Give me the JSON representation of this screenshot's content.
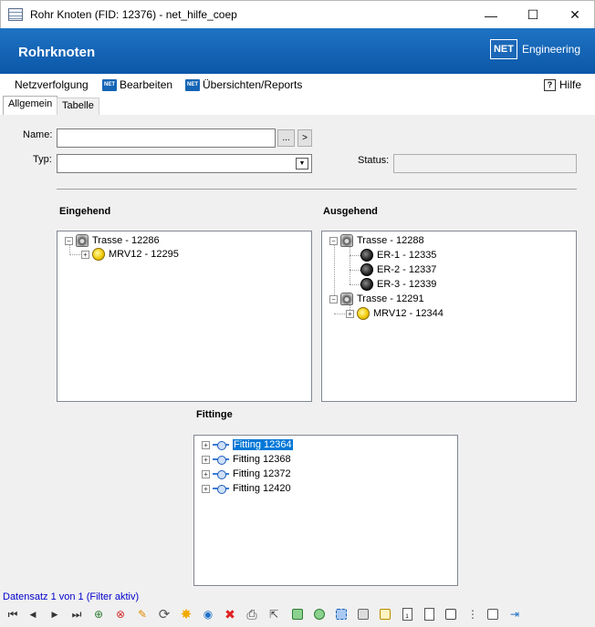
{
  "window": {
    "title": "Rohr Knoten (FID: 12376) - net_hilfe_coep",
    "minimize_glyph": "—",
    "maximize_glyph": "☐",
    "close_glyph": "✕"
  },
  "banner": {
    "heading": "Rohrknoten",
    "logo_box": "NET",
    "logo_text": "Engineering"
  },
  "menu": {
    "netzverfolgung": "Netzverfolgung",
    "bearbeiten": "Bearbeiten",
    "uebersichten": "Übersichten/Reports",
    "hilfe": "Hilfe",
    "net_icon_text": "NET",
    "help_icon_text": "?"
  },
  "tabs": [
    {
      "label": "Allgemein"
    },
    {
      "label": "Tabelle"
    }
  ],
  "form": {
    "name_label": "Name:",
    "name_value": "",
    "browse_label": "...",
    "goto_label": ">",
    "typ_label": "Typ:",
    "typ_value": "",
    "status_label": "Status:",
    "status_value": ""
  },
  "eingehend": {
    "title": "Eingehend",
    "nodes": [
      {
        "label": "Trasse - 12286"
      },
      {
        "label": "MRV12 - 12295"
      }
    ]
  },
  "ausgehend": {
    "title": "Ausgehend",
    "nodes": [
      {
        "label": "Trasse - 12288"
      },
      {
        "label": "ER-1 - 12335"
      },
      {
        "label": "ER-2 - 12337"
      },
      {
        "label": "ER-3 - 12339"
      },
      {
        "label": "Trasse - 12291"
      },
      {
        "label": "MRV12 - 12344"
      }
    ]
  },
  "fittinge": {
    "title": "Fittinge",
    "nodes": [
      {
        "label": "Fitting 12364"
      },
      {
        "label": "Fitting 12368"
      },
      {
        "label": "Fitting 12372"
      },
      {
        "label": "Fitting 12420"
      }
    ]
  },
  "status_bar": {
    "text": "Datensatz 1 von 1 (Filter aktiv)"
  },
  "toolbar": {
    "first": "⏮",
    "prev": "◀",
    "next": "▶",
    "last": "⏭",
    "filter_add": "⊕",
    "filter_remove": "⊗",
    "edit": "✎",
    "refresh": "⟳",
    "new": "✸",
    "web": "◉",
    "delete": "✖",
    "print": "⎙",
    "select": "⇱",
    "doc_text": "1"
  },
  "colors": {
    "banner": "#0b57a8",
    "selection": "#0078d7",
    "status_text": "#0000cc",
    "delete": "#e02020"
  }
}
